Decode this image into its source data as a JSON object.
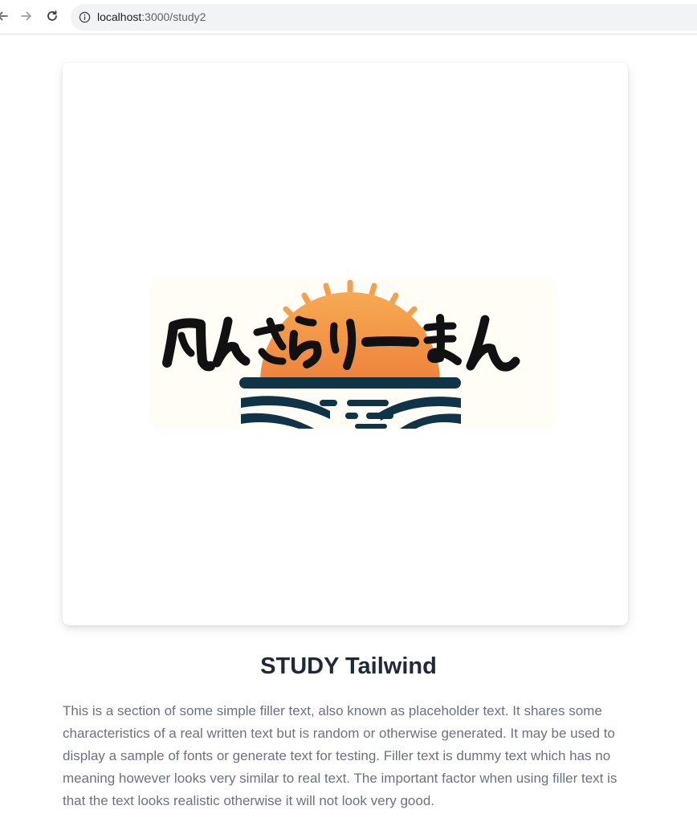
{
  "browser": {
    "url_host": "localhost",
    "url_path": ":3000/study2",
    "icons": [
      "back-arrow-icon",
      "forward-arrow-icon",
      "reload-icon",
      "info-icon"
    ]
  },
  "hero": {
    "logo_text": "ふんさらりーまん",
    "logo_colors": {
      "sun_top": "#f6a24a",
      "sun_bottom": "#e9612a",
      "waves": "#0f3447",
      "background": "#fffdf6",
      "lettering": "#111111"
    }
  },
  "main": {
    "title": "STUDY Tailwind",
    "paragraph": "This is a section of some simple filler text, also known as placeholder text. It shares some characteristics of a real written text but is random or otherwise generated. It may be used to display a sample of fonts or generate text for testing. Filler text is dummy text which has no meaning however looks very similar to real text. The important factor when using filler text is that the text looks realistic otherwise it will not look very good."
  }
}
